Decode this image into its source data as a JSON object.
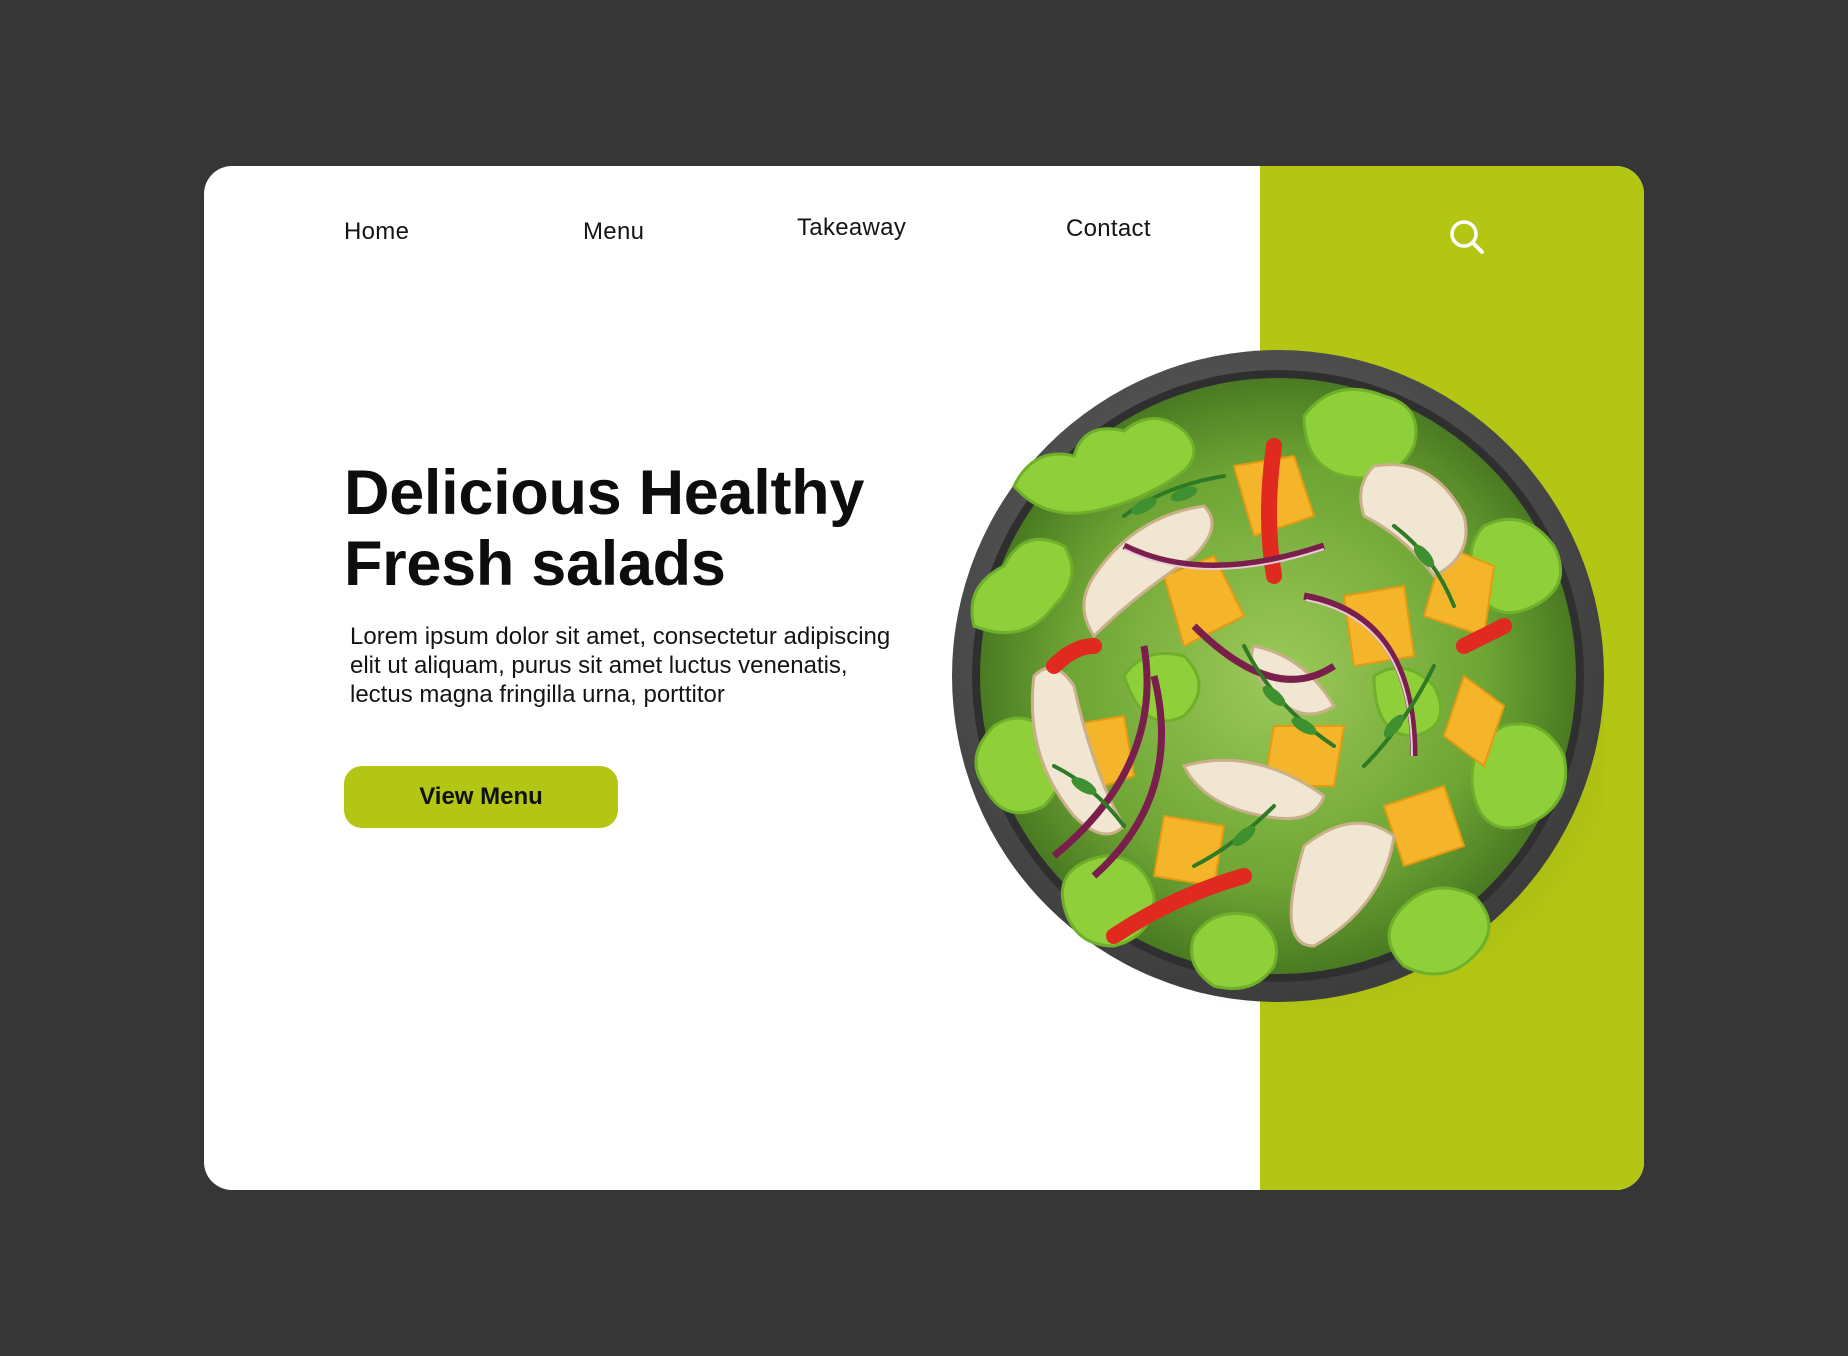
{
  "nav": {
    "items": [
      "Home",
      "Menu",
      "Takeaway",
      "Contact"
    ],
    "search_icon": "search-icon"
  },
  "hero": {
    "title_line1": "Delicious Healthy",
    "title_line2": "Fresh salads",
    "description": "Lorem ipsum dolor sit amet, consectetur adipiscing elit ut aliquam, purus sit amet luctus venenatis, lectus magna fringilla urna, porttitor",
    "cta_label": "View Menu",
    "image_subject": "salad-bowl"
  },
  "colors": {
    "background": "#363636",
    "card": "#ffffff",
    "accent": "#b3c614",
    "text": "#0d0d0d"
  }
}
